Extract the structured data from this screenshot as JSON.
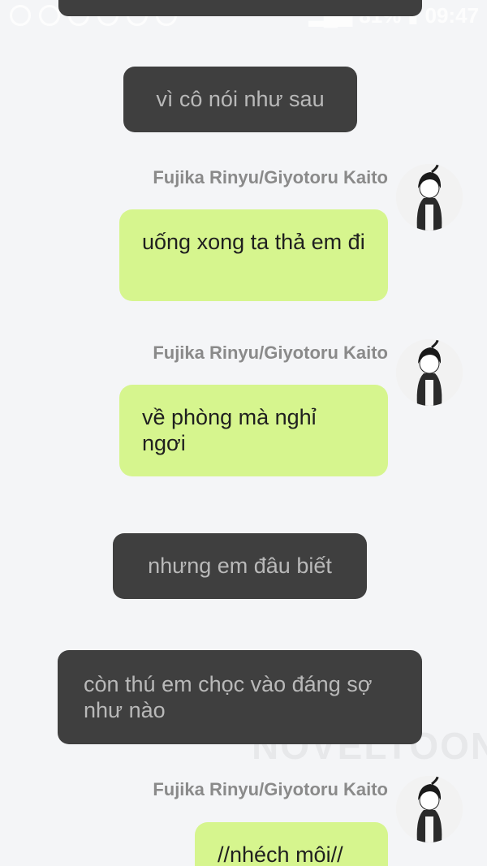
{
  "status_bar": {
    "battery": "81%",
    "time": "09:47",
    "icons": [
      "message-icon",
      "image-icon",
      "chat-icon",
      "pinterest-icon",
      "chrome-icon",
      "chrome-icon",
      "chrome-icon",
      "chrome-icon",
      "battery-saver-icon",
      "mute-icon",
      "alarm-icon",
      "wifi-icon",
      "signal-icon"
    ]
  },
  "watermark": "NOVELTOON",
  "messages": [
    {
      "type": "narration",
      "text": "vì cô nói như sau"
    },
    {
      "type": "character",
      "speaker": "Fujika Rinyu/Giyotoru Kaito",
      "text": "uống xong ta thả em đi"
    },
    {
      "type": "character",
      "speaker": "Fujika Rinyu/Giyotoru Kaito",
      "text": "về phòng mà nghỉ ngơi"
    },
    {
      "type": "narration",
      "text": "nhưng em đâu biết"
    },
    {
      "type": "narration",
      "text": "còn thú em chọc vào đáng sợ như nào"
    },
    {
      "type": "character",
      "speaker": "Fujika Rinyu/Giyotoru Kaito",
      "text": "//nhéch môi//"
    }
  ],
  "colors": {
    "background": "#f4f5f7",
    "narration_bubble": "#3f3f3f",
    "narration_text": "#b9b9b9",
    "character_bubble": "#d6f58e",
    "speaker_text": "#8a8a8a"
  }
}
